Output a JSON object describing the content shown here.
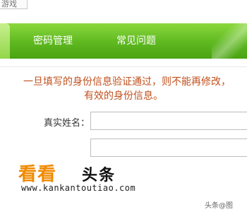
{
  "top": {
    "search_text": "游戏"
  },
  "nav": {
    "items": [
      {
        "label": "密码管理"
      },
      {
        "label": "常见问题"
      }
    ]
  },
  "notice": {
    "line1": "一旦填写的身份信息验证通过，则不能再修改，",
    "line2": "有效的身份信息。"
  },
  "form": {
    "name_label": "真实姓名：",
    "name_value": "",
    "second_value": ""
  },
  "watermark": {
    "logo_orange": "看看",
    "logo_black": "头条",
    "url": "www.kankantoutiao.com",
    "corner": "头条@图"
  },
  "colors": {
    "nav_green": "#5eb820",
    "notice_orange": "#c0501c",
    "logo_orange": "#f08a00"
  }
}
